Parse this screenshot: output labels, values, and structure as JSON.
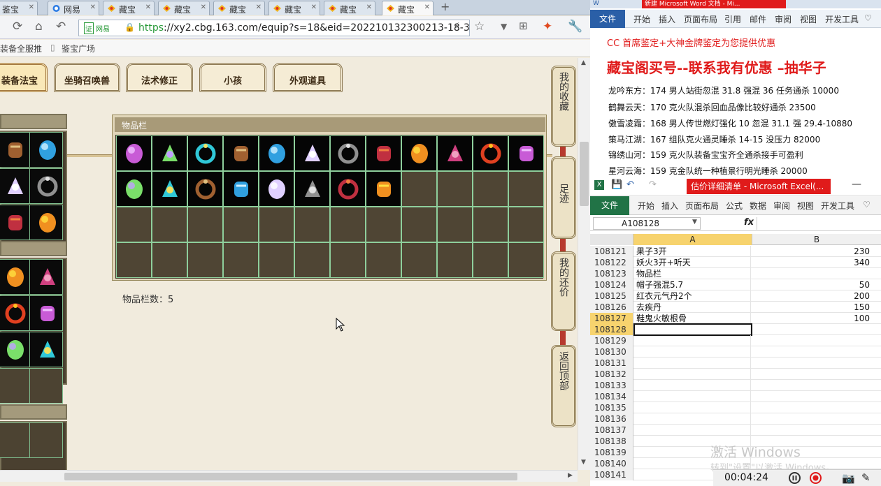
{
  "browser": {
    "tabs": [
      {
        "label": "鉴宝"
      },
      {
        "label": "网易"
      },
      {
        "label": "藏宝"
      },
      {
        "label": "藏宝"
      },
      {
        "label": "藏宝"
      },
      {
        "label": "藏宝"
      },
      {
        "label": "藏宝"
      },
      {
        "label": "藏宝"
      }
    ],
    "new_tab": "+",
    "url_cert": "网易",
    "url_scheme": "https",
    "url_rest": "://xy2.cbg.163.com/equip?s=18&eid=202210132300213-18-3",
    "bookmarks": [
      "装备全服推",
      "鉴宝广场"
    ]
  },
  "game": {
    "tabs": [
      {
        "label": "装备法宝"
      },
      {
        "label": "坐骑召唤兽"
      },
      {
        "label": "法术修正"
      },
      {
        "label": "小孩"
      },
      {
        "label": "外观道具"
      }
    ],
    "inventory_title": "物品栏",
    "inventory_count": "物品栏数：5",
    "sidebar": [
      {
        "label": "我的收藏"
      },
      {
        "label": "足迹"
      },
      {
        "label": "我的还价"
      },
      {
        "label": "返回顶部"
      }
    ]
  },
  "word": {
    "title": "新建 Microsoft Word 文档 - Mi...",
    "file_tab": "文件",
    "ribbon_tabs": [
      "开始",
      "插入",
      "页面布局",
      "引用",
      "邮件",
      "审阅",
      "视图",
      "开发工具"
    ],
    "line1": "CC 首席鉴定+大神金牌鉴定为您提供优惠",
    "line2": "藏宝阁买号--联系我有优惠 –抽华子",
    "rows": [
      "龙吟东方：174 男人站街忽混 31.8 强混 36 任务通杀 10000",
      "鹤舞云天：170 克火队混杀回血品像比较好通杀 23500",
      "傲雪凌霜：168 男人传世燃灯强化 10 忽混 31.1 强 29.4-10880",
      "策马江湖：167 组队克火通灵睡杀 14-15 没压力 82000",
      "锦绣山河：159 克火队装备宝宝齐全通杀接手可盈利",
      "星河云海：159 克金队统一种植景行明光睡杀 20000"
    ]
  },
  "excel": {
    "title": "估价详细清单 - Microsoft Excel(...",
    "file_tab": "文件",
    "ribbon_tabs": [
      "开始",
      "插入",
      "页面布局",
      "公式",
      "数据",
      "审阅",
      "视图",
      "开发工具"
    ],
    "name_box": "A108128",
    "fx": "fx",
    "col_a": "A",
    "col_b": "B",
    "rows": [
      {
        "n": "108121",
        "a": "果子3开",
        "b": "230"
      },
      {
        "n": "108122",
        "a": "妖火3开+听天",
        "b": "340"
      },
      {
        "n": "108123",
        "a": "物品栏",
        "b": ""
      },
      {
        "n": "108124",
        "a": "帽子强混5.7",
        "b": "50"
      },
      {
        "n": "108125",
        "a": "红衣元气丹2个",
        "b": "200"
      },
      {
        "n": "108126",
        "a": "去疾丹",
        "b": "150"
      },
      {
        "n": "108127",
        "a": "鞋鬼火敏根骨",
        "b": "100"
      },
      {
        "n": "108128",
        "a": "",
        "b": ""
      },
      {
        "n": "108129",
        "a": "",
        "b": ""
      },
      {
        "n": "108130",
        "a": "",
        "b": ""
      },
      {
        "n": "108131",
        "a": "",
        "b": ""
      },
      {
        "n": "108132",
        "a": "",
        "b": ""
      },
      {
        "n": "108133",
        "a": "",
        "b": ""
      },
      {
        "n": "108134",
        "a": "",
        "b": ""
      },
      {
        "n": "108135",
        "a": "",
        "b": ""
      },
      {
        "n": "108136",
        "a": "",
        "b": ""
      },
      {
        "n": "108137",
        "a": "",
        "b": ""
      },
      {
        "n": "108138",
        "a": "",
        "b": ""
      },
      {
        "n": "108139",
        "a": "",
        "b": ""
      },
      {
        "n": "108140",
        "a": "",
        "b": ""
      },
      {
        "n": "108141",
        "a": "",
        "b": ""
      }
    ]
  },
  "overlay": {
    "watermark": "激活 Windows",
    "watermark_sub": "转到\"设置\"以激活 Windows。",
    "recording_time": "00:04:24"
  },
  "colors": {
    "accent_red": "#e01b1b",
    "excel_green": "#217346",
    "word_blue": "#2a5fa7",
    "grid_line": "#8ecf9c"
  }
}
